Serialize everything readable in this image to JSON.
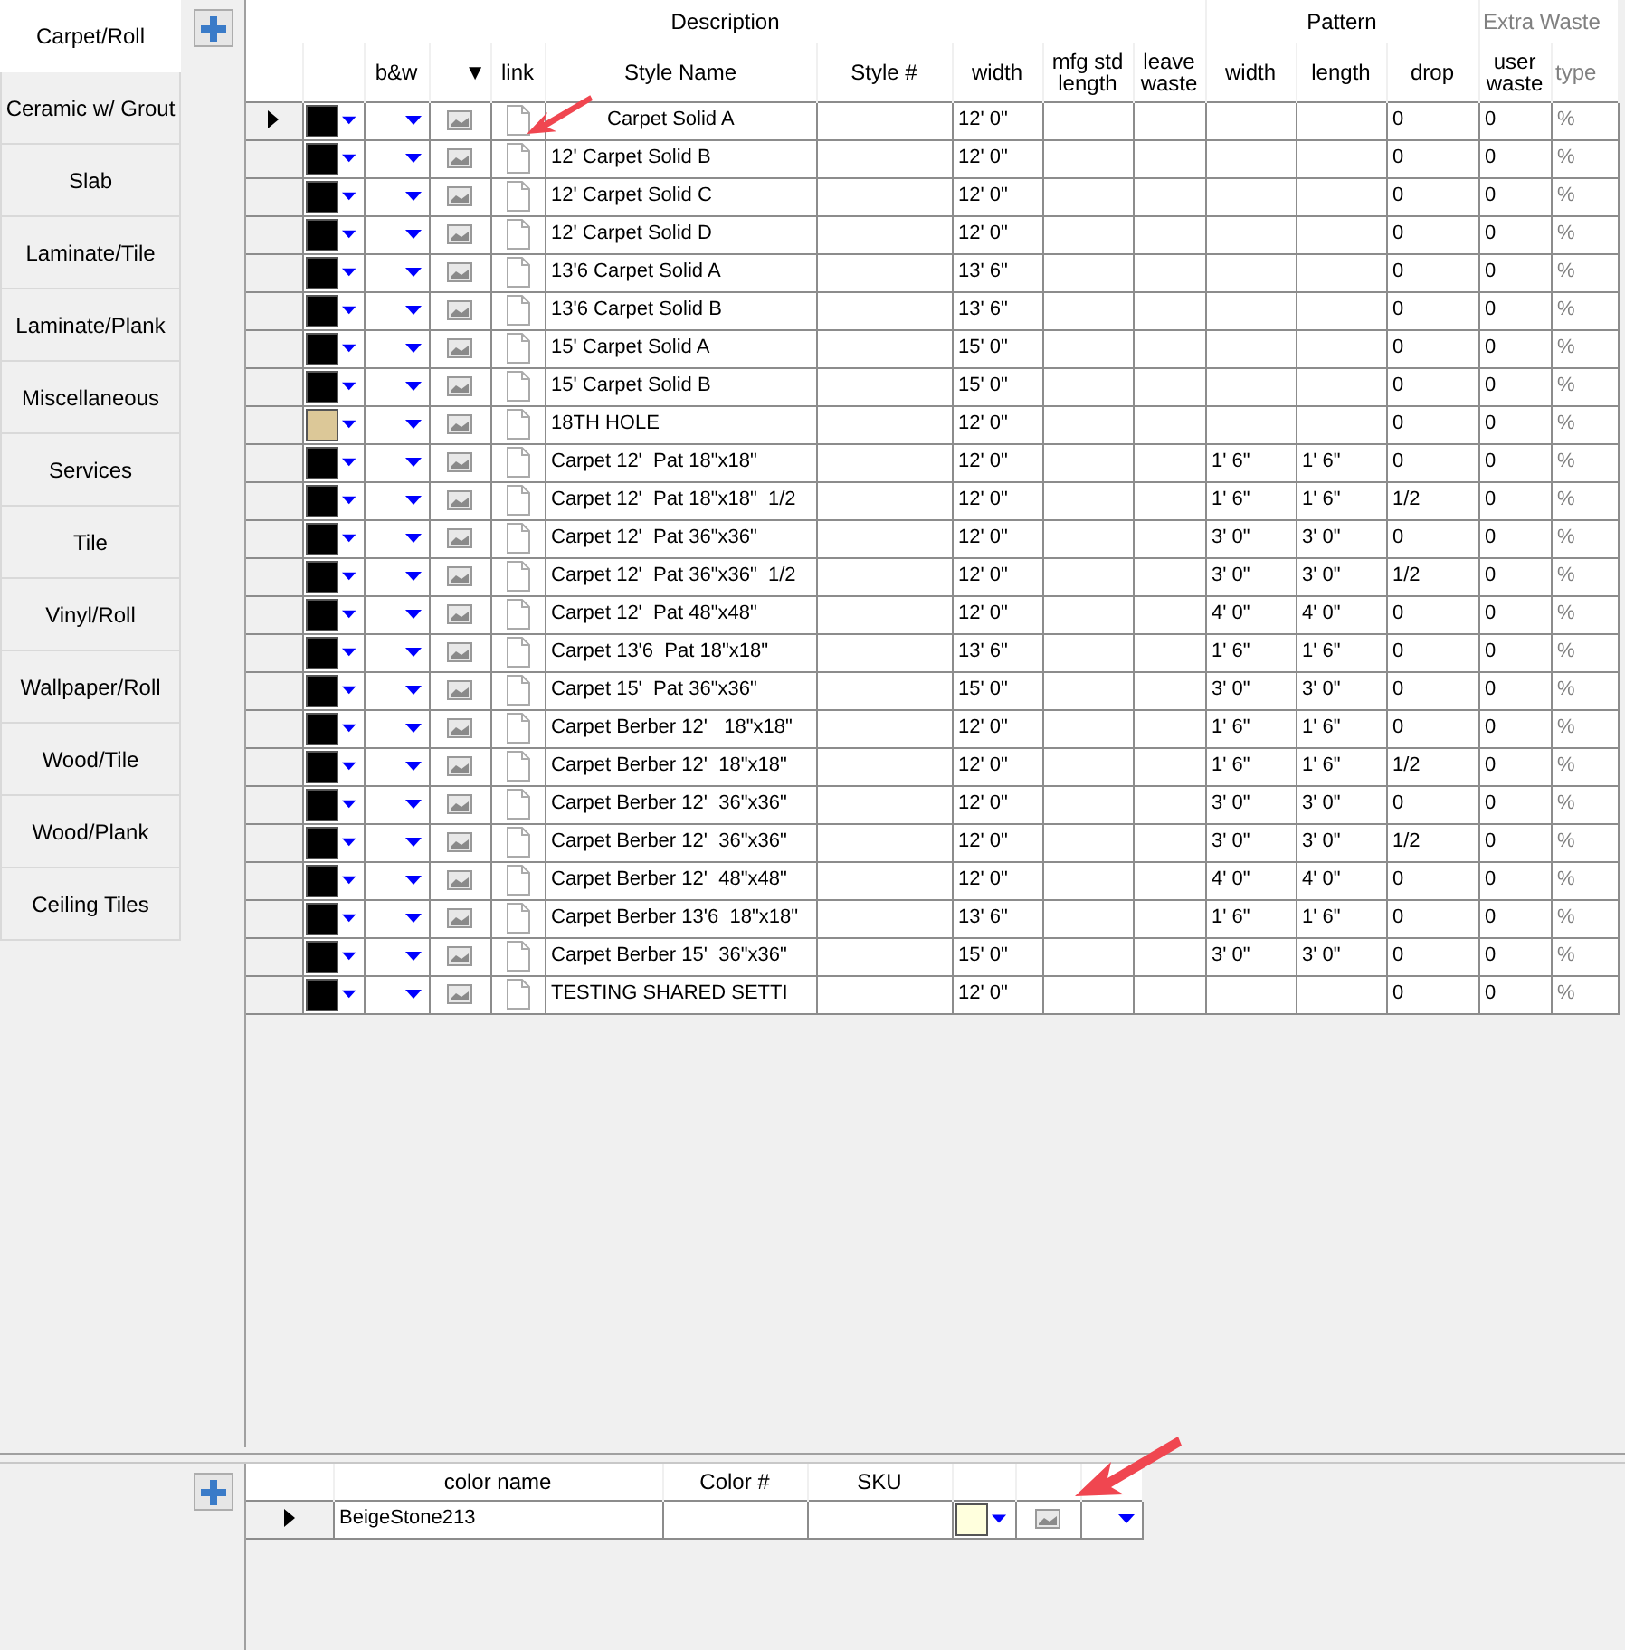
{
  "tabs": [
    {
      "label": "Carpet/Roll",
      "selected": true
    },
    {
      "label": "Ceramic w/ Grout",
      "selected": false
    },
    {
      "label": "Slab",
      "selected": false
    },
    {
      "label": "Laminate/Tile",
      "selected": false
    },
    {
      "label": "Laminate/Plank",
      "selected": false
    },
    {
      "label": "Miscellaneous",
      "selected": false
    },
    {
      "label": "Services",
      "selected": false
    },
    {
      "label": "Tile",
      "selected": false
    },
    {
      "label": "Vinyl/Roll",
      "selected": false
    },
    {
      "label": "Wallpaper/Roll",
      "selected": false
    },
    {
      "label": "Wood/Tile",
      "selected": false
    },
    {
      "label": "Wood/Plank",
      "selected": false
    },
    {
      "label": "Ceiling Tiles",
      "selected": false
    }
  ],
  "styles_grid": {
    "group_headers": [
      "Description",
      "Pattern",
      "Extra Waste"
    ],
    "columns": [
      "b&w",
      "▼",
      "link",
      "Style Name",
      "Style #",
      "width",
      "mfg std length",
      "leave waste",
      "width",
      "length",
      "drop",
      "user waste",
      "type"
    ],
    "rows": [
      {
        "current": true,
        "color": "#000000",
        "style_name": "Carpet Solid A",
        "width": "12' 0\"",
        "pattern_width": "",
        "pattern_length": "",
        "drop": "0",
        "user_waste": "0",
        "type": "%"
      },
      {
        "current": false,
        "color": "#000000",
        "style_name": "12' Carpet Solid B",
        "width": "12' 0\"",
        "pattern_width": "",
        "pattern_length": "",
        "drop": "0",
        "user_waste": "0",
        "type": "%"
      },
      {
        "current": false,
        "color": "#000000",
        "style_name": "12' Carpet Solid C",
        "width": "12' 0\"",
        "pattern_width": "",
        "pattern_length": "",
        "drop": "0",
        "user_waste": "0",
        "type": "%"
      },
      {
        "current": false,
        "color": "#000000",
        "style_name": "12' Carpet Solid D",
        "width": "12' 0\"",
        "pattern_width": "",
        "pattern_length": "",
        "drop": "0",
        "user_waste": "0",
        "type": "%"
      },
      {
        "current": false,
        "color": "#000000",
        "style_name": "13'6 Carpet Solid A",
        "width": "13' 6\"",
        "pattern_width": "",
        "pattern_length": "",
        "drop": "0",
        "user_waste": "0",
        "type": "%"
      },
      {
        "current": false,
        "color": "#000000",
        "style_name": "13'6 Carpet Solid B",
        "width": "13' 6\"",
        "pattern_width": "",
        "pattern_length": "",
        "drop": "0",
        "user_waste": "0",
        "type": "%"
      },
      {
        "current": false,
        "color": "#000000",
        "style_name": "15' Carpet Solid A",
        "width": "15' 0\"",
        "pattern_width": "",
        "pattern_length": "",
        "drop": "0",
        "user_waste": "0",
        "type": "%"
      },
      {
        "current": false,
        "color": "#000000",
        "style_name": "15' Carpet Solid B",
        "width": "15' 0\"",
        "pattern_width": "",
        "pattern_length": "",
        "drop": "0",
        "user_waste": "0",
        "type": "%"
      },
      {
        "current": false,
        "color": "#dcc898",
        "style_name": "18TH HOLE",
        "width": "12' 0\"",
        "pattern_width": "",
        "pattern_length": "",
        "drop": "0",
        "user_waste": "0",
        "type": "%"
      },
      {
        "current": false,
        "color": "#000000",
        "style_name": "Carpet 12'  Pat 18\"x18\"",
        "width": "12' 0\"",
        "pattern_width": "1' 6\"",
        "pattern_length": "1' 6\"",
        "drop": "0",
        "user_waste": "0",
        "type": "%"
      },
      {
        "current": false,
        "color": "#000000",
        "style_name": "Carpet 12'  Pat 18\"x18\"  1/2",
        "width": "12' 0\"",
        "pattern_width": "1' 6\"",
        "pattern_length": "1' 6\"",
        "drop": "1/2",
        "user_waste": "0",
        "type": "%"
      },
      {
        "current": false,
        "color": "#000000",
        "style_name": "Carpet 12'  Pat 36\"x36\"",
        "width": "12' 0\"",
        "pattern_width": "3' 0\"",
        "pattern_length": "3' 0\"",
        "drop": "0",
        "user_waste": "0",
        "type": "%"
      },
      {
        "current": false,
        "color": "#000000",
        "style_name": "Carpet 12'  Pat 36\"x36\"  1/2",
        "width": "12' 0\"",
        "pattern_width": "3' 0\"",
        "pattern_length": "3' 0\"",
        "drop": "1/2",
        "user_waste": "0",
        "type": "%"
      },
      {
        "current": false,
        "color": "#000000",
        "style_name": "Carpet 12'  Pat 48\"x48\"",
        "width": "12' 0\"",
        "pattern_width": "4' 0\"",
        "pattern_length": "4' 0\"",
        "drop": "0",
        "user_waste": "0",
        "type": "%"
      },
      {
        "current": false,
        "color": "#000000",
        "style_name": "Carpet 13'6  Pat 18\"x18\"",
        "width": "13' 6\"",
        "pattern_width": "1' 6\"",
        "pattern_length": "1' 6\"",
        "drop": "0",
        "user_waste": "0",
        "type": "%"
      },
      {
        "current": false,
        "color": "#000000",
        "style_name": "Carpet 15'  Pat 36\"x36\"",
        "width": "15' 0\"",
        "pattern_width": "3' 0\"",
        "pattern_length": "3' 0\"",
        "drop": "0",
        "user_waste": "0",
        "type": "%"
      },
      {
        "current": false,
        "color": "#000000",
        "style_name": "Carpet Berber 12'   18\"x18\"",
        "width": "12' 0\"",
        "pattern_width": "1' 6\"",
        "pattern_length": "1' 6\"",
        "drop": "0",
        "user_waste": "0",
        "type": "%"
      },
      {
        "current": false,
        "color": "#000000",
        "style_name": "Carpet Berber 12'  18\"x18\"",
        "width": "12' 0\"",
        "pattern_width": "1' 6\"",
        "pattern_length": "1' 6\"",
        "drop": "1/2",
        "user_waste": "0",
        "type": "%"
      },
      {
        "current": false,
        "color": "#000000",
        "style_name": "Carpet Berber 12'  36\"x36\"",
        "width": "12' 0\"",
        "pattern_width": "3' 0\"",
        "pattern_length": "3' 0\"",
        "drop": "0",
        "user_waste": "0",
        "type": "%"
      },
      {
        "current": false,
        "color": "#000000",
        "style_name": "Carpet Berber 12'  36\"x36\"",
        "width": "12' 0\"",
        "pattern_width": "3' 0\"",
        "pattern_length": "3' 0\"",
        "drop": "1/2",
        "user_waste": "0",
        "type": "%"
      },
      {
        "current": false,
        "color": "#000000",
        "style_name": "Carpet Berber 12'  48\"x48\"",
        "width": "12' 0\"",
        "pattern_width": "4' 0\"",
        "pattern_length": "4' 0\"",
        "drop": "0",
        "user_waste": "0",
        "type": "%"
      },
      {
        "current": false,
        "color": "#000000",
        "style_name": "Carpet Berber 13'6  18\"x18\"",
        "width": "13' 6\"",
        "pattern_width": "1' 6\"",
        "pattern_length": "1' 6\"",
        "drop": "0",
        "user_waste": "0",
        "type": "%"
      },
      {
        "current": false,
        "color": "#000000",
        "style_name": "Carpet Berber 15'  36\"x36\"",
        "width": "15' 0\"",
        "pattern_width": "3' 0\"",
        "pattern_length": "3' 0\"",
        "drop": "0",
        "user_waste": "0",
        "type": "%"
      },
      {
        "current": false,
        "color": "#000000",
        "style_name": "TESTING SHARED SETTI",
        "width": "12' 0\"",
        "pattern_width": "",
        "pattern_length": "",
        "drop": "0",
        "user_waste": "0",
        "type": "%"
      }
    ]
  },
  "colors_grid": {
    "columns": [
      "color name",
      "Color #",
      "SKU"
    ],
    "rows": [
      {
        "current": true,
        "color_name": "BeigeStone213",
        "color": "#ffffdd"
      }
    ]
  }
}
